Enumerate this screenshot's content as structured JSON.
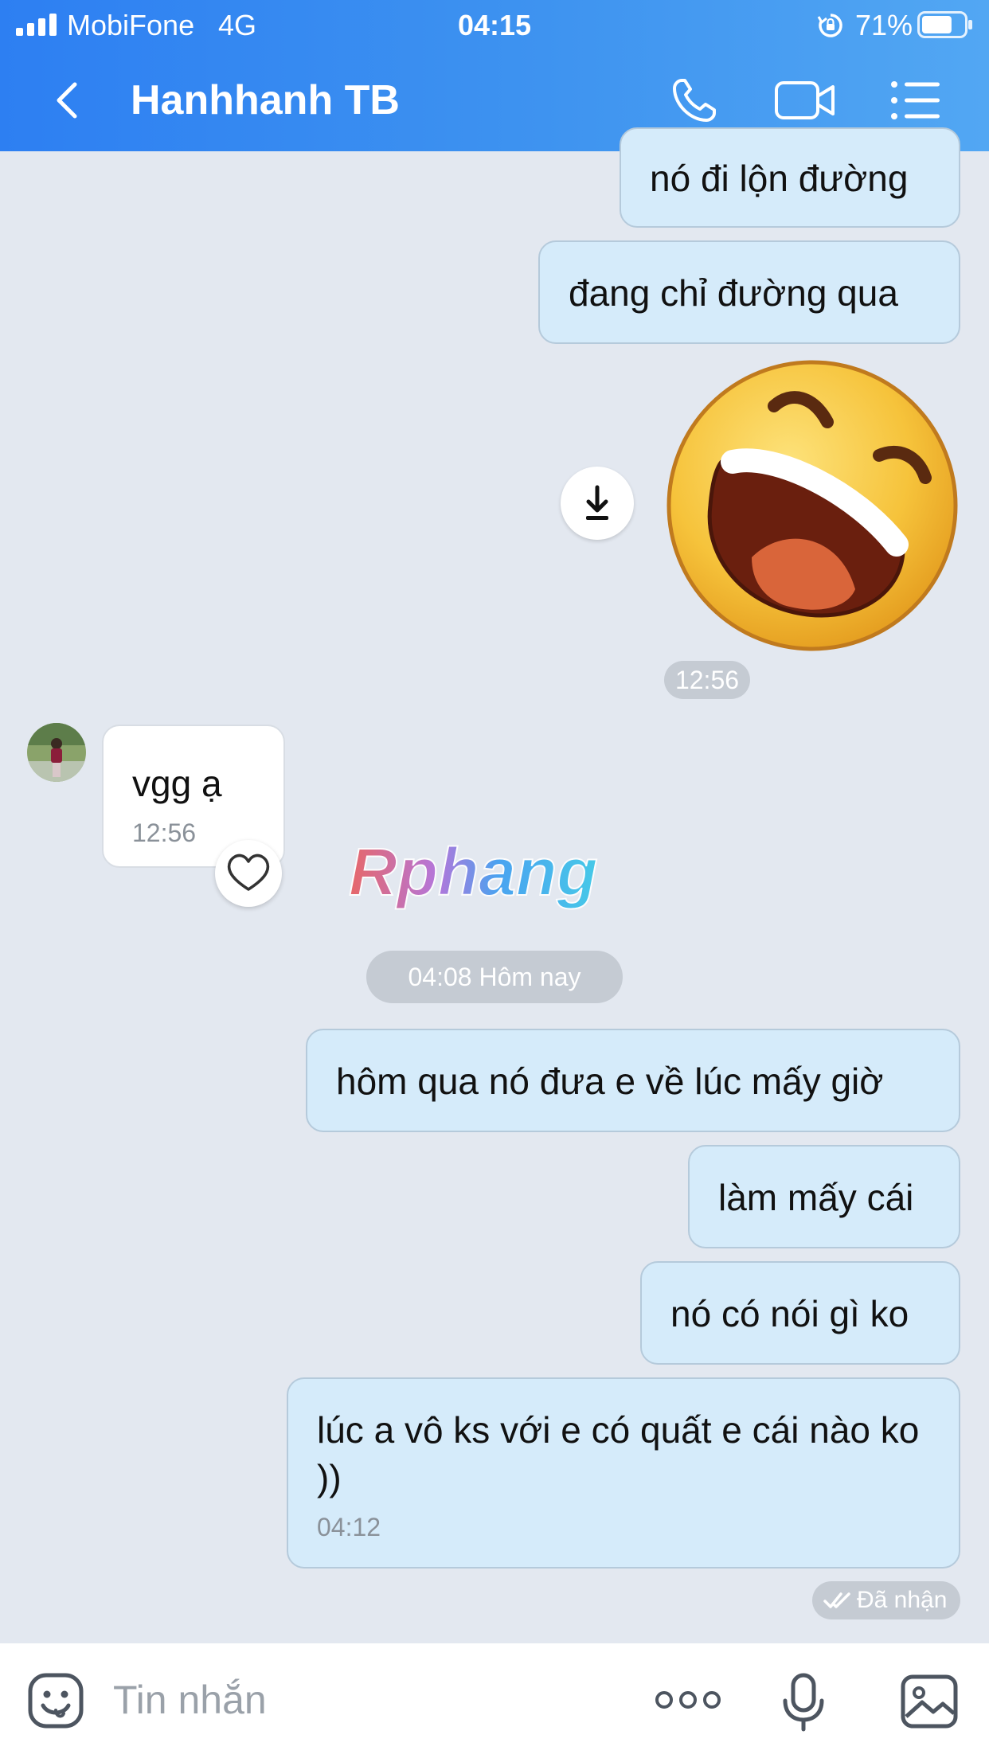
{
  "status_bar": {
    "carrier": "MobiFone",
    "network": "4G",
    "time": "04:15",
    "battery_percent": "71%",
    "battery_level": 0.71
  },
  "header": {
    "contact_name": "Hanhhanh TB",
    "icons": [
      "back-icon",
      "phone-icon",
      "video-camera-icon",
      "menu-icon"
    ]
  },
  "messages": [
    {
      "direction": "out",
      "text": "nó đi lộn đường"
    },
    {
      "direction": "out",
      "text": "đang chỉ đường qua"
    },
    {
      "direction": "out",
      "type": "sticker",
      "sticker": "laughing-emoji"
    },
    {
      "type": "timestamp",
      "text": "12:56"
    },
    {
      "direction": "in",
      "text": "vgg ạ",
      "time": "12:56"
    },
    {
      "type": "date-divider",
      "text": "04:08 Hôm nay"
    },
    {
      "direction": "out",
      "text": "hôm qua nó đưa e về lúc mấy giờ"
    },
    {
      "direction": "out",
      "text": "làm mấy cái"
    },
    {
      "direction": "out",
      "text": "nó có nói gì ko"
    },
    {
      "direction": "out",
      "text": "lúc a vô ks với e có quất e cái nào ko ))",
      "time": "04:12"
    }
  ],
  "read_status": "Đã nhận",
  "watermark": "Rphang",
  "composer": {
    "placeholder": "Tin nhắn",
    "icons": [
      "emoji-icon",
      "more-icon",
      "microphone-icon",
      "image-icon"
    ]
  },
  "colors": {
    "header_start": "#2d7ff2",
    "header_end": "#52a7f3",
    "outgoing_bubble": "#d5ebfa",
    "incoming_bubble": "#ffffff",
    "chat_background": "#e3e8f0"
  }
}
